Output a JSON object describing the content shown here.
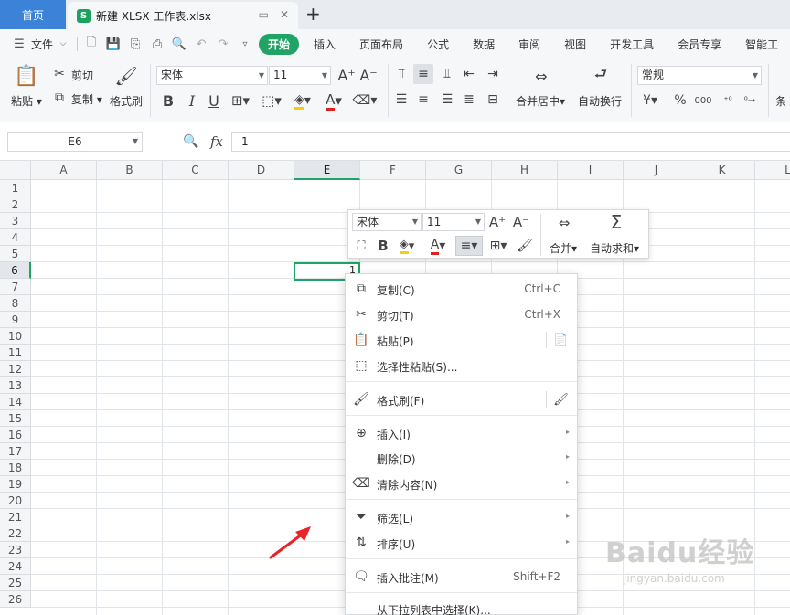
{
  "titlebar": {
    "home_tab": "首页",
    "file_tab_icon": "S",
    "file_tab": "新建 XLSX 工作表.xlsx",
    "new_tab": "+"
  },
  "menubar": {
    "file_menu": "文件",
    "tabs": [
      {
        "label": "开始",
        "active": true
      },
      {
        "label": "插入"
      },
      {
        "label": "页面布局"
      },
      {
        "label": "公式"
      },
      {
        "label": "数据"
      },
      {
        "label": "审阅"
      },
      {
        "label": "视图"
      },
      {
        "label": "开发工具"
      },
      {
        "label": "会员专享"
      },
      {
        "label": "智能工"
      }
    ]
  },
  "ribbon": {
    "paste": "粘贴",
    "cut": "剪切",
    "copy": "复制",
    "format_painter": "格式刷",
    "font_name": "宋体",
    "font_size": "11",
    "merge_center": "合并居中",
    "wrap_text": "自动换行",
    "number_format": "常规",
    "currency_symbol": "¥",
    "percent_symbol": "%",
    "thousands": "000",
    "cond_format_partial": "条"
  },
  "formula_bar": {
    "name_box": "E6",
    "fx": "fx",
    "value": "1"
  },
  "grid": {
    "columns": [
      "A",
      "B",
      "C",
      "D",
      "E",
      "F",
      "G",
      "H",
      "I",
      "J",
      "K",
      "L"
    ],
    "rows": [
      "1",
      "2",
      "3",
      "4",
      "5",
      "6",
      "7",
      "8",
      "9",
      "10",
      "11",
      "12",
      "13",
      "14",
      "15",
      "16",
      "17",
      "18",
      "19",
      "20",
      "21",
      "22",
      "23",
      "24",
      "25",
      "26"
    ],
    "active_col": "E",
    "active_row": "6",
    "cell_value": "1"
  },
  "mini_toolbar": {
    "font_name": "宋体",
    "font_size": "11",
    "merge": "合并",
    "autosum": "自动求和"
  },
  "context_menu": {
    "items": [
      {
        "label": "复制(C)",
        "shortcut": "Ctrl+C",
        "icon": "copy-icon"
      },
      {
        "label": "剪切(T)",
        "shortcut": "Ctrl+X",
        "icon": "cut-icon"
      },
      {
        "label": "粘贴(P)",
        "icon": "paste-icon"
      },
      {
        "label": "选择性粘贴(S)...",
        "icon": "paste-special-icon"
      },
      {
        "label": "格式刷(F)",
        "icon": "format-painter-icon"
      },
      {
        "label": "插入(I)",
        "icon": "insert-icon"
      },
      {
        "label": "删除(D)"
      },
      {
        "label": "清除内容(N)",
        "icon": "eraser-icon"
      },
      {
        "label": "筛选(L)",
        "icon": "filter-icon"
      },
      {
        "label": "排序(U)",
        "icon": "sort-icon"
      },
      {
        "label": "插入批注(M)",
        "shortcut": "Shift+F2",
        "icon": "comment-icon"
      },
      {
        "label": "从下拉列表中选择(K)..."
      }
    ]
  },
  "watermark": {
    "brand": "Baidu经验",
    "url": "jingyan.baidu.com"
  },
  "colors": {
    "accent": "#21a366",
    "home_tab": "#3b82d8",
    "arrow": "#e8232a"
  }
}
